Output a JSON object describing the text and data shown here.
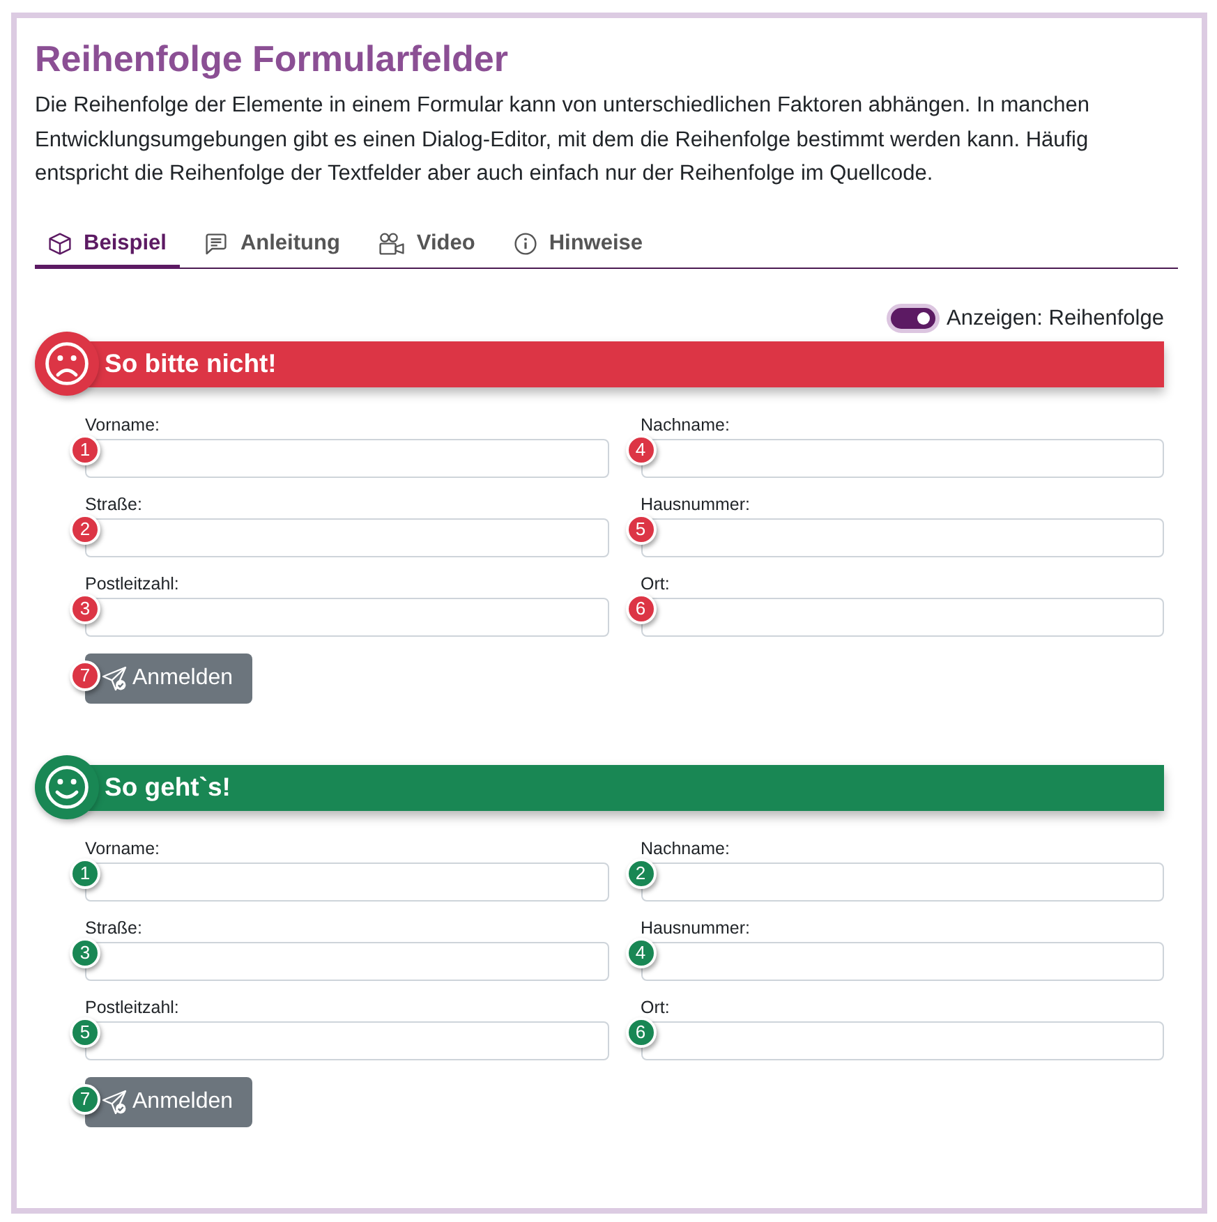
{
  "page": {
    "title": "Reihenfolge Formularfelder",
    "intro": "Die Reihenfolge der Elemente in einem Formular kann von unterschiedlichen Faktoren abhängen. In manchen Entwicklungsumgebungen gibt es einen Dialog-Editor, mit dem die Reihenfolge bestimmt werden kann. Häufig entspricht die Reihenfolge der Textfelder aber auch einfach nur der Reihenfolge im Quellcode."
  },
  "tabs": [
    {
      "label": "Beispiel",
      "selected": true
    },
    {
      "label": "Anleitung",
      "selected": false
    },
    {
      "label": "Video",
      "selected": false
    },
    {
      "label": "Hinweise",
      "selected": false
    }
  ],
  "toggle": {
    "label": "Anzeigen: Reihenfolge",
    "on": true
  },
  "sections": [
    {
      "kind": "negative",
      "color": "#dc3545",
      "title": "So bitte nicht!",
      "fields": [
        {
          "label": "Vorname:",
          "order": "1"
        },
        {
          "label": "Nachname:",
          "order": "4"
        },
        {
          "label": "Straße:",
          "order": "2"
        },
        {
          "label": "Hausnummer:",
          "order": "5"
        },
        {
          "label": "Postleitzahl:",
          "order": "3"
        },
        {
          "label": "Ort:",
          "order": "6"
        }
      ],
      "button": {
        "label": "Anmelden",
        "order": "7"
      }
    },
    {
      "kind": "positive",
      "color": "#198754",
      "title": "So geht`s!",
      "fields": [
        {
          "label": "Vorname:",
          "order": "1"
        },
        {
          "label": "Nachname:",
          "order": "2"
        },
        {
          "label": "Straße:",
          "order": "3"
        },
        {
          "label": "Hausnummer:",
          "order": "4"
        },
        {
          "label": "Postleitzahl:",
          "order": "5"
        },
        {
          "label": "Ort:",
          "order": "6"
        }
      ],
      "button": {
        "label": "Anmelden",
        "order": "7"
      }
    }
  ]
}
